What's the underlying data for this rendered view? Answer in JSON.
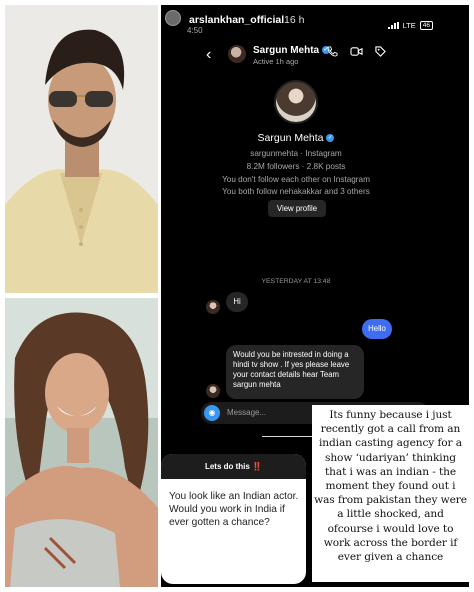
{
  "story": {
    "username": "arslankhan_official",
    "time_ago": "16 h",
    "clock": "4:50",
    "network": "LTE",
    "battery": "46"
  },
  "chat_header": {
    "back_icon": "chevron-left-icon",
    "name": "Sargun Mehta",
    "status": "Active 1h ago",
    "icons": [
      "phone-icon",
      "video-icon",
      "tag-icon"
    ]
  },
  "profile": {
    "name": "Sargun Mehta",
    "handle_line": "sargunmehta · Instagram",
    "stats": "8.2M followers · 2.8K posts",
    "follow_note": "You don't follow each other on Instagram",
    "mutual": "You both follow nehakakkar and 3 others",
    "view_button": "View profile"
  },
  "messages": {
    "divider": "YESTERDAY AT 13:48",
    "incoming_1": "Hi",
    "outgoing_1": "Hello",
    "incoming_2": "Would you be intrested in doing a hindi tv show . If yes please leave your contact details hear Team sargun mehta"
  },
  "composer": {
    "placeholder": "Message..."
  },
  "question_card": {
    "header": "Lets do this ‼️",
    "text": "You look like an Indian actor. Would you work in India if ever gotten a chance?"
  },
  "caption": "Its funny because i just recently got a call from an indian casting agency for a show ‘udariyan’ thinking that i was an indian - the moment they found out i was from pakistan they were a little shocked, and ofcourse i would love to work across the border if ever given a chance",
  "colors": {
    "verified": "#3897f0",
    "outgoing_bubble": "#3f6df2",
    "incoming_bubble": "#262626"
  }
}
